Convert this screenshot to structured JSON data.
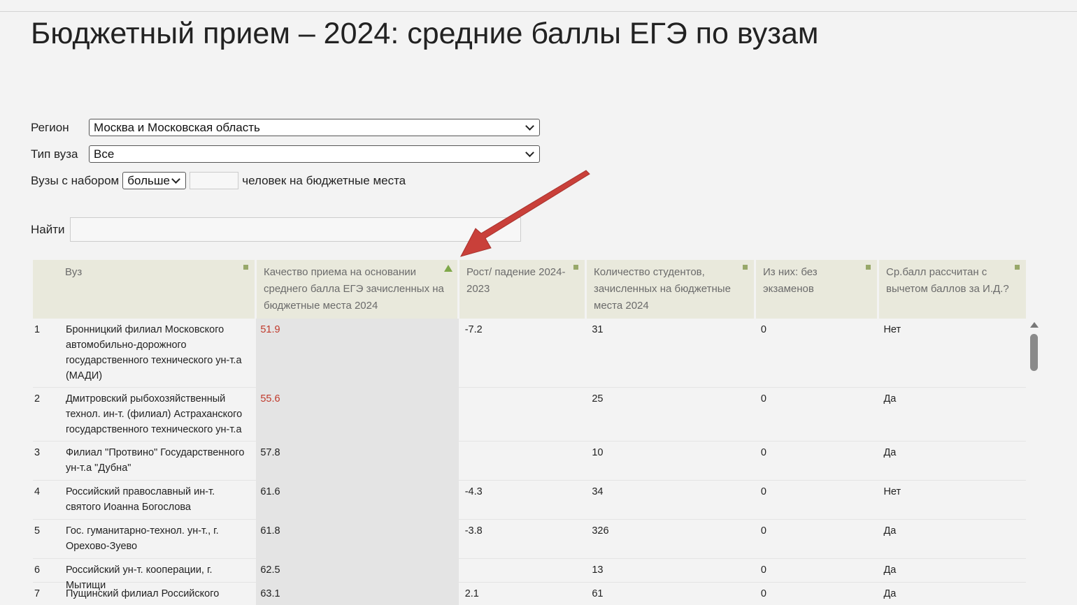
{
  "page": {
    "title": "Бюджетный прием – 2024: средние баллы ЕГЭ по вузам"
  },
  "filters": {
    "region_label": "Регион",
    "region_value": "Москва и Московская область",
    "type_label": "Тип вуза",
    "type_value": "Все",
    "count_label": "Вузы с набором",
    "count_compare": "больше",
    "count_value": "",
    "count_suffix": "человек на бюджетные места",
    "search_label": "Найти",
    "search_value": ""
  },
  "table": {
    "headers": {
      "name": "Вуз",
      "quality": "Качество приема на основании среднего балла ЕГЭ зачисленных на бюджетные места 2024",
      "delta": "Рост/ падение 2024-2023",
      "count": "Количество студентов, зачисленных на бюджетные места 2024",
      "no_exam": "Из них: без экзаменов",
      "adjusted": "Ср.балл рассчитан с вычетом баллов за И.Д.?"
    },
    "rows": [
      {
        "idx": "1",
        "name": "Бронницкий филиал Московского автомобильно-дорожного государственного технического ун-т.а (МАДИ)",
        "quality": "51.9",
        "delta": "-7.2",
        "count": "31",
        "no_exam": "0",
        "adjusted": "Нет"
      },
      {
        "idx": "2",
        "name": "Дмитровский рыбохозяйственный технол. ин-т. (филиал) Астраханского государственного технического ун-т.а",
        "quality": "55.6",
        "delta": "",
        "count": "25",
        "no_exam": "0",
        "adjusted": "Да"
      },
      {
        "idx": "3",
        "name": "Филиал \"Протвино\" Государственного ун-т.а \"Дубна\"",
        "quality": "57.8",
        "delta": "",
        "count": "10",
        "no_exam": "0",
        "adjusted": "Да"
      },
      {
        "idx": "4",
        "name": "Российский православный ин-т. святого Иоанна Богослова",
        "quality": "61.6",
        "delta": "-4.3",
        "count": "34",
        "no_exam": "0",
        "adjusted": "Нет"
      },
      {
        "idx": "5",
        "name": "Гос. гуманитарно-технол. ун-т., г. Орехово-Зуево",
        "quality": "61.8",
        "delta": "-3.8",
        "count": "326",
        "no_exam": "0",
        "adjusted": "Да"
      },
      {
        "idx": "6",
        "name": "Российский ун-т. кооперации, г. Мытищи",
        "quality": "62.5",
        "delta": "",
        "count": "13",
        "no_exam": "0",
        "adjusted": "Да"
      },
      {
        "idx": "7",
        "name": "Пущинский филиал Российского",
        "quality": "63.1",
        "delta": "2.1",
        "count": "61",
        "no_exam": "0",
        "adjusted": "Да"
      }
    ]
  },
  "colors": {
    "header_bg": "#e9e9dc",
    "low_score": "#c0392b",
    "sort_active": "#7fa84a",
    "arrow": "#c9403a"
  }
}
